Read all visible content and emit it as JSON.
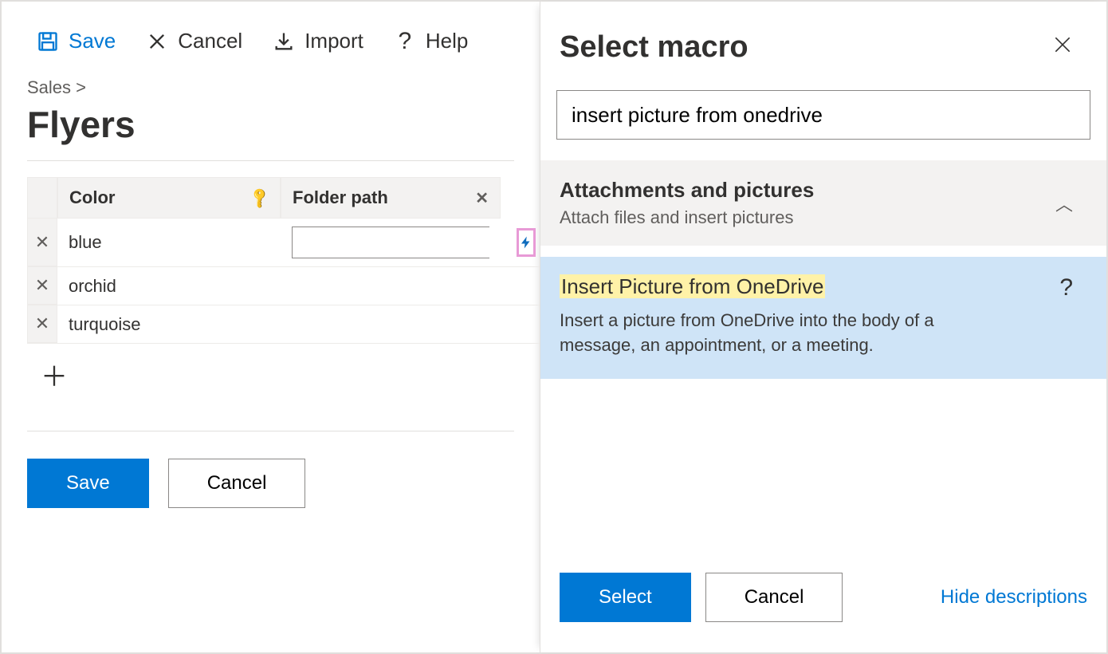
{
  "toolbar": {
    "save": "Save",
    "cancel": "Cancel",
    "import": "Import",
    "help": "Help"
  },
  "breadcrumb": {
    "parent": "Sales",
    "sep": ">"
  },
  "page": {
    "title": "Flyers"
  },
  "grid": {
    "headers": {
      "color": "Color",
      "path": "Folder path"
    },
    "rows": [
      {
        "color": "blue",
        "path": ""
      },
      {
        "color": "orchid",
        "path": ""
      },
      {
        "color": "turquoise",
        "path": ""
      }
    ]
  },
  "form": {
    "save": "Save",
    "cancel": "Cancel"
  },
  "panel": {
    "title": "Select macro",
    "search_value": "insert picture from onedrive",
    "category": {
      "title": "Attachments and pictures",
      "subtitle": "Attach files and insert pictures"
    },
    "macro": {
      "title": "Insert Picture from OneDrive",
      "desc": "Insert a picture from OneDrive into the body of a message, an appointment, or a meeting."
    },
    "footer": {
      "select": "Select",
      "cancel": "Cancel",
      "toggle": "Hide descriptions"
    }
  }
}
